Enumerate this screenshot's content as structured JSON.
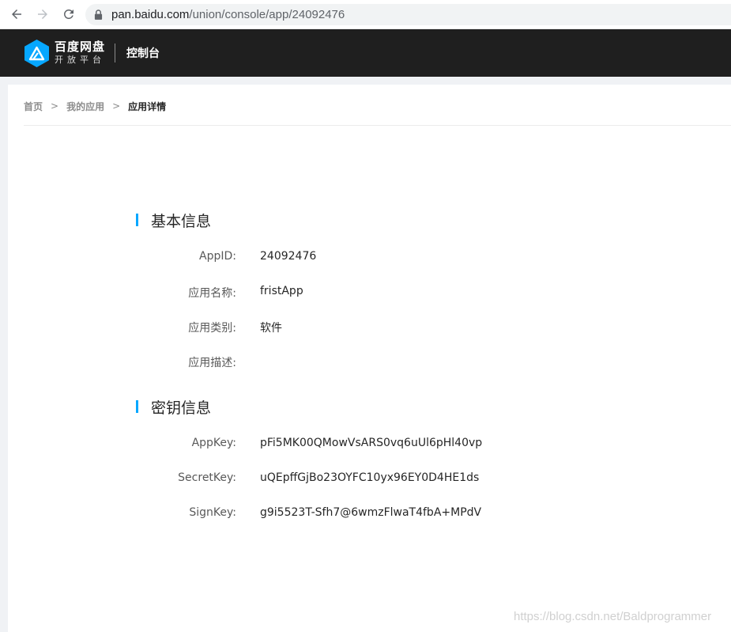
{
  "browser": {
    "url_host": "pan.baidu.com",
    "url_path": "/union/console/app/24092476"
  },
  "topnav": {
    "logo_line1": "百度网盘",
    "logo_line2": "开放平台",
    "console_label": "控制台"
  },
  "breadcrumb": {
    "home": "首页",
    "my_apps": "我的应用",
    "current": "应用详情",
    "separator": ">"
  },
  "basic_info": {
    "title": "基本信息",
    "rows": [
      {
        "label": "AppID:",
        "value": "24092476"
      },
      {
        "label": "应用名称:",
        "value": "fristApp"
      },
      {
        "label": "应用类别:",
        "value": "软件"
      },
      {
        "label": "应用描述:",
        "value": ""
      }
    ]
  },
  "key_info": {
    "title": "密钥信息",
    "rows": [
      {
        "label": "AppKey:",
        "value": "pFi5MK00QMowVsARS0vq6uUl6pHl40vp"
      },
      {
        "label": "SecretKey:",
        "value": "uQEpffGjBo23OYFC10yx96EY0D4HE1ds"
      },
      {
        "label": "SignKey:",
        "value": "g9i5523T-Sfh7@6wmzFlwaT4fbA+MPdV"
      }
    ]
  },
  "watermark": "https://blog.csdn.net/Baldprogrammer",
  "colors": {
    "accent": "#06a7ff",
    "navbar": "#1f1f1f"
  }
}
